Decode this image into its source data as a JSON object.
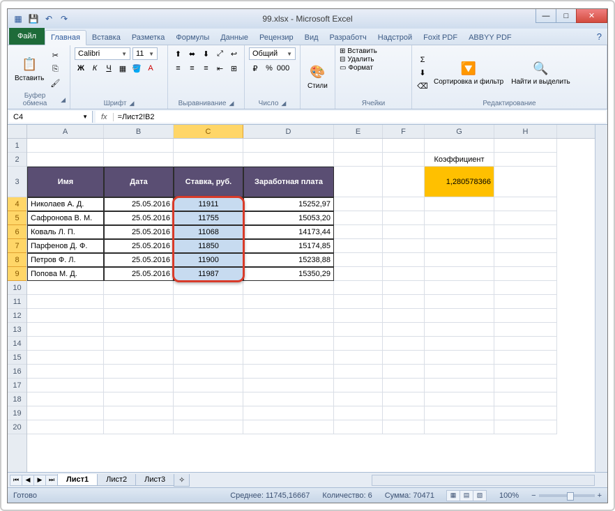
{
  "title": "99.xlsx - Microsoft Excel",
  "qat": {
    "save": "💾",
    "undo": "↶",
    "redo": "↷"
  },
  "tabs": {
    "file": "Файл",
    "items": [
      "Главная",
      "Вставка",
      "Разметка",
      "Формулы",
      "Данные",
      "Рецензир",
      "Вид",
      "Разработч",
      "Надстрой",
      "Foxit PDF",
      "ABBYY PDF"
    ],
    "active": 0
  },
  "ribbon": {
    "clipboard": {
      "paste": "Вставить",
      "label": "Буфер обмена"
    },
    "font": {
      "name": "Calibri",
      "size": "11",
      "label": "Шрифт",
      "bold": "Ж",
      "italic": "К",
      "underline": "Ч"
    },
    "align": {
      "label": "Выравнивание"
    },
    "number": {
      "format": "Общий",
      "label": "Число"
    },
    "styles": {
      "btn": "Стили",
      "label": ""
    },
    "cells": {
      "insert": "Вставить",
      "delete": "Удалить",
      "format": "Формат",
      "label": "Ячейки"
    },
    "editing": {
      "sort": "Сортировка и фильтр",
      "find": "Найти и выделить",
      "label": "Редактирование"
    }
  },
  "namebox": "C4",
  "formula": "=Лист2!B2",
  "columns": [
    "A",
    "B",
    "C",
    "D",
    "E",
    "F",
    "G",
    "H"
  ],
  "rows": [
    "1",
    "2",
    "3",
    "4",
    "5",
    "6",
    "7",
    "8",
    "9",
    "10",
    "11",
    "12",
    "13",
    "14",
    "15",
    "16",
    "17",
    "18",
    "19",
    "20"
  ],
  "coef_label": "Коэффициент",
  "coef_value": "1,280578366",
  "headers": {
    "name": "Имя",
    "date": "Дата",
    "rate": "Ставка, руб.",
    "salary": "Заработная плата"
  },
  "data": [
    {
      "name": "Николаев А. Д.",
      "date": "25.05.2016",
      "rate": "11911",
      "salary": "15252,97"
    },
    {
      "name": "Сафронова В. М.",
      "date": "25.05.2016",
      "rate": "11755",
      "salary": "15053,20"
    },
    {
      "name": "Коваль Л. П.",
      "date": "25.05.2016",
      "rate": "11068",
      "salary": "14173,44"
    },
    {
      "name": "Парфенов Д. Ф.",
      "date": "25.05.2016",
      "rate": "11850",
      "salary": "15174,85"
    },
    {
      "name": "Петров Ф. Л.",
      "date": "25.05.2016",
      "rate": "11900",
      "salary": "15238,88"
    },
    {
      "name": "Попова М. Д.",
      "date": "25.05.2016",
      "rate": "11987",
      "salary": "15350,29"
    }
  ],
  "sheets": [
    "Лист1",
    "Лист2",
    "Лист3"
  ],
  "status": {
    "ready": "Готово",
    "avg": "Среднее: 11745,16667",
    "count": "Количество: 6",
    "sum": "Сумма: 70471",
    "zoom": "100%"
  }
}
